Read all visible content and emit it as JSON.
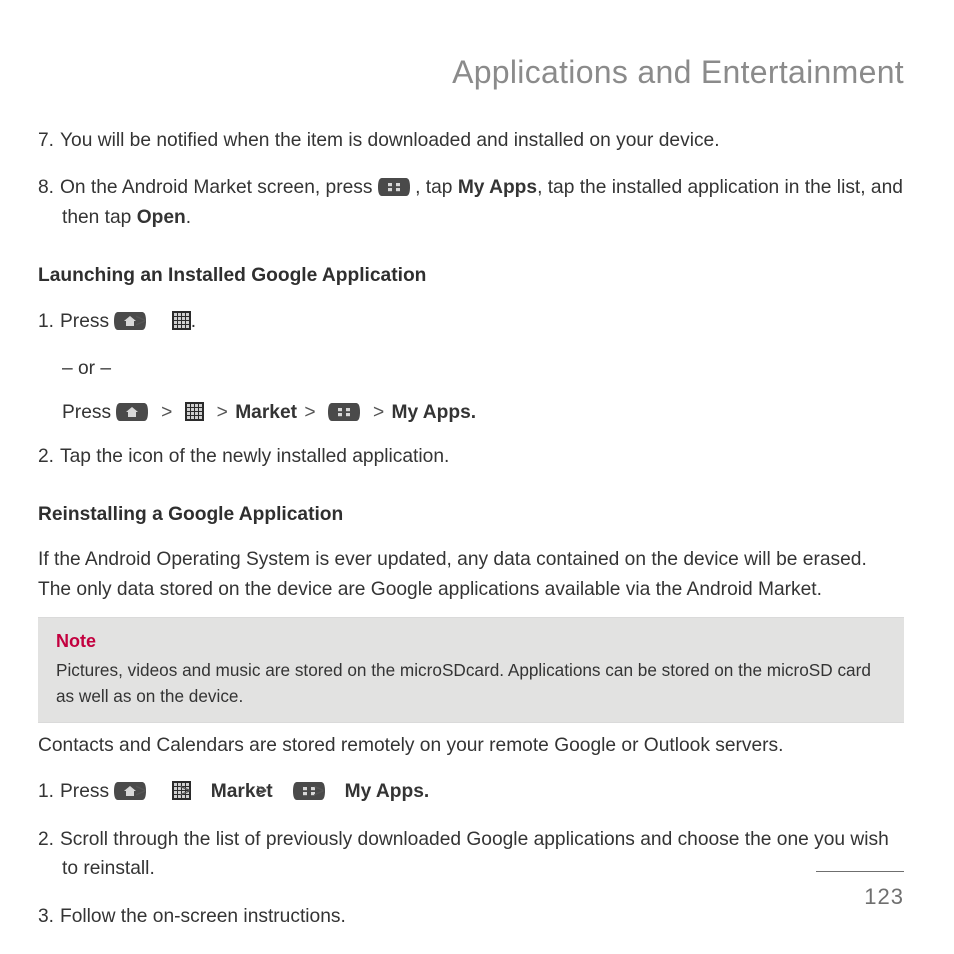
{
  "title": "Applications and Entertainment",
  "items7": {
    "num": "7.",
    "text": "You will be notified when the item is downloaded and installed on your device."
  },
  "items8": {
    "num": "8.",
    "pre": "On the Android Market screen, press ",
    "mid1": " , tap ",
    "b1": "My Apps",
    "mid2": ", tap the installed application in the list, and then tap ",
    "b2": "Open",
    "post": "."
  },
  "section_launch": "Launching an Installed Google Application",
  "launch1": {
    "num": "1.",
    "word": "Press ",
    "dot": "."
  },
  "launch1_or": "– or –",
  "launch1b": {
    "word": "Press ",
    "market": "Market",
    "myapps": "My Apps."
  },
  "launch2": {
    "num": "2.",
    "text": "Tap the icon of the newly installed application."
  },
  "section_reinstall": "Reinstalling a Google Application",
  "reinstall_intro": "If the Android Operating System is ever updated, any data contained on the device will be erased. The only data stored on the device are Google applications available via the Android Market.",
  "note": {
    "label": "Note",
    "body": "Pictures, videos and music are stored on the microSDcard. Applications can be stored on the microSD card as well as on the device."
  },
  "after_note": "Contacts and Calendars are stored remotely on your remote Google or Outlook servers.",
  "re1": {
    "num": "1.",
    "word": "Press ",
    "market": "Market",
    "myapps": "My Apps."
  },
  "re2": {
    "num": "2.",
    "text": "Scroll through the list of previously downloaded Google applications and choose the one you wish to reinstall."
  },
  "re3": {
    "num": "3.",
    "text": "Follow the on-screen instructions."
  },
  "chev": ">",
  "page_number": "123"
}
